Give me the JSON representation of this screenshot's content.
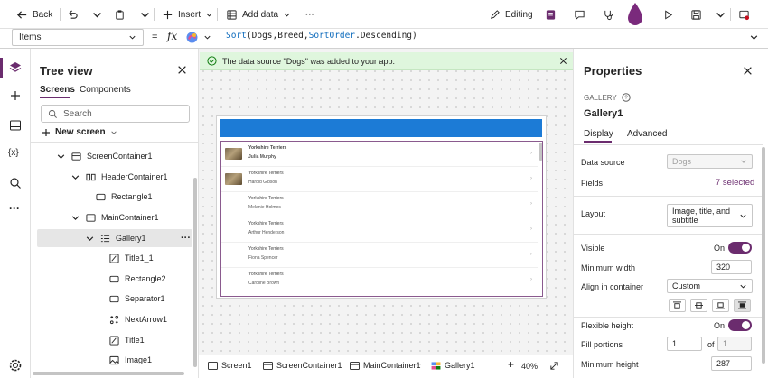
{
  "toolbar": {
    "back_label": "Back",
    "insert_label": "Insert",
    "add_data_label": "Add data",
    "more_label": "···",
    "editing_label": "Editing"
  },
  "formula_bar": {
    "property": "Items",
    "fx_label": "fx",
    "formula_tokens": [
      "Sort",
      "(",
      "Dogs",
      ",",
      "Breed",
      ",",
      "SortOrder",
      ".",
      "Descending",
      ")"
    ]
  },
  "tree": {
    "title": "Tree view",
    "tabs": [
      "Screens",
      "Components"
    ],
    "search_placeholder": "Search",
    "new_screen_label": "New screen",
    "nodes": [
      {
        "label": "ScreenContainer1",
        "icon": "container-icon"
      },
      {
        "label": "HeaderContainer1",
        "icon": "horizontal-container-icon"
      },
      {
        "label": "Rectangle1",
        "icon": "rectangle-icon"
      },
      {
        "label": "MainContainer1",
        "icon": "container-icon"
      },
      {
        "label": "Gallery1",
        "icon": "gallery-icon"
      },
      {
        "label": "Title1_1",
        "icon": "label-icon"
      },
      {
        "label": "Rectangle2",
        "icon": "rectangle-icon"
      },
      {
        "label": "Separator1",
        "icon": "rectangle-icon"
      },
      {
        "label": "NextArrow1",
        "icon": "icon-control-icon"
      },
      {
        "label": "Title1",
        "icon": "label-icon"
      },
      {
        "label": "Image1",
        "icon": "image-icon"
      }
    ],
    "node_more": "···"
  },
  "banner": {
    "message": "The data source \"Dogs\" was added to your app."
  },
  "gallery": {
    "items": [
      {
        "title": "Yorkshire Terriers",
        "subtitle": "Julia Murphy"
      },
      {
        "title": "Yorkshire Terriers",
        "subtitle": "Harold Gibson"
      },
      {
        "title": "Yorkshire Terriers",
        "subtitle": "Melanie Holmes"
      },
      {
        "title": "Yorkshire Terriers",
        "subtitle": "Arthur Henderson"
      },
      {
        "title": "Yorkshire Terriers",
        "subtitle": "Fiona Spencer"
      },
      {
        "title": "Yorkshire Terriers",
        "subtitle": "Caroline Brown"
      }
    ],
    "arrow": "›"
  },
  "statusbar": {
    "crumbs": [
      "Screen1",
      "ScreenContainer1",
      "MainContainer1",
      "Gallery1"
    ],
    "zoom_minus": "—",
    "zoom_plus": "+",
    "zoom": "40%"
  },
  "properties": {
    "title": "Properties",
    "control_type": "GALLERY",
    "control_name": "Gallery1",
    "tabs": [
      "Display",
      "Advanced"
    ],
    "data_source_label": "Data source",
    "data_source_value": "Dogs",
    "fields_label": "Fields",
    "fields_value": "7 selected",
    "layout_label": "Layout",
    "layout_value": "Image, title, and subtitle",
    "visible_label": "Visible",
    "visible_value": "On",
    "min_width_label": "Minimum width",
    "min_width_value": "320",
    "align_label": "Align in container",
    "align_value": "Custom",
    "flex_height_label": "Flexible height",
    "flex_height_value": "On",
    "fill_portions_label": "Fill portions",
    "fill_portions_value": "1",
    "fill_portions_of": "of",
    "fill_portions_total": "1",
    "min_height_label": "Minimum height",
    "min_height_value": "287"
  },
  "colors": {
    "accent": "#6b2c6e",
    "header_blue": "#1c7bd6",
    "banner_green": "#dff6dd",
    "success_green": "#107c10"
  }
}
